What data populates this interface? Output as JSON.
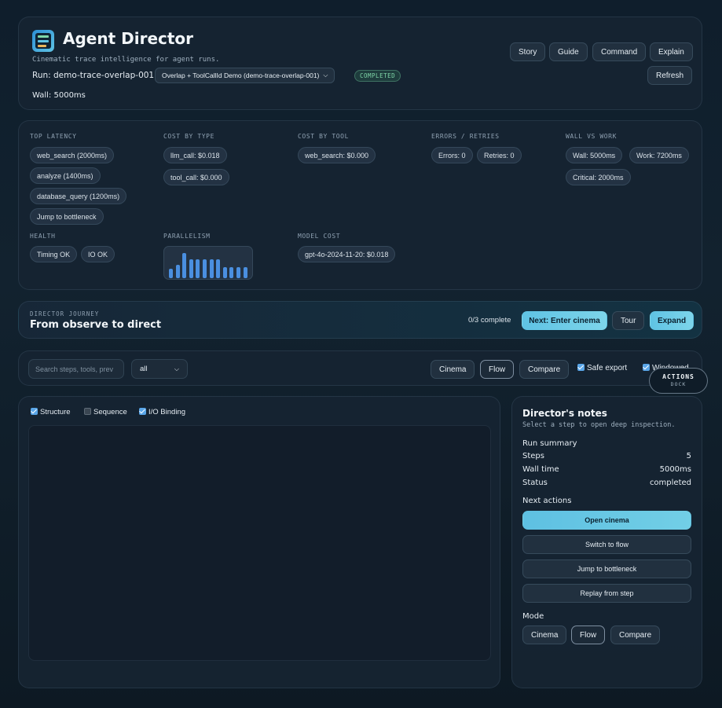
{
  "header": {
    "title": "Agent Director",
    "subtitle": "Cinematic trace intelligence for agent runs.",
    "run_label": "Run: demo-trace-overlap-001",
    "run_select": "Overlap + ToolCallId Demo (demo-trace-overlap-001)",
    "status_badge": "COMPLETED",
    "wall": "Wall: 5000ms",
    "buttons": {
      "story": "Story",
      "guide": "Guide",
      "command": "Command",
      "explain": "Explain",
      "refresh": "Refresh"
    }
  },
  "metrics": {
    "top_latency": {
      "label": "TOP LATENCY",
      "items": [
        "web_search (2000ms)",
        "analyze (1400ms)",
        "database_query (1200ms)",
        "Jump to bottleneck"
      ]
    },
    "cost_by_type": {
      "label": "COST BY TYPE",
      "items": [
        "llm_call: $0.018",
        "tool_call: $0.000"
      ]
    },
    "cost_by_tool": {
      "label": "COST BY TOOL",
      "items": [
        "web_search: $0.000"
      ]
    },
    "errors_retries": {
      "label": "ERRORS / RETRIES",
      "items": [
        "Errors: 0",
        "Retries: 0"
      ]
    },
    "wall_vs_work": {
      "label": "WALL VS WORK",
      "items": [
        "Wall: 5000ms",
        "Work: 7200ms",
        "Critical: 2000ms"
      ]
    },
    "health": {
      "label": "HEALTH",
      "items": [
        "Timing OK",
        "IO OK"
      ]
    },
    "parallelism": {
      "label": "PARALLELISM",
      "bar_levels": [
        0.35,
        0.5,
        0.95,
        0.7,
        0.7,
        0.7,
        0.7,
        0.7,
        0.4,
        0.4,
        0.4,
        0.4
      ]
    },
    "model_cost": {
      "label": "MODEL COST",
      "items": [
        "gpt-4o-2024-11-20: $0.018"
      ]
    }
  },
  "journey": {
    "eyebrow": "DIRECTOR JOURNEY",
    "title": "From observe to direct",
    "progress": "0/3 complete",
    "next_button": "Next: Enter cinema",
    "tour_button": "Tour",
    "expand_button": "Expand"
  },
  "toolbar": {
    "search_placeholder": "Search steps, tools, prev",
    "filter_value": "all",
    "cinema": "Cinema",
    "flow": "Flow",
    "compare": "Compare",
    "safe_export": "Safe export",
    "windowed": "Windowed",
    "actions_dock_title": "ACTIONS",
    "actions_dock_sub": "DOCK"
  },
  "canvas": {
    "toggles": [
      {
        "label": "Structure",
        "checked": true
      },
      {
        "label": "Sequence",
        "checked": false
      },
      {
        "label": "I/O Binding",
        "checked": true
      }
    ]
  },
  "notes": {
    "title": "Director's notes",
    "subtitle": "Select a step to open deep inspection.",
    "summary_title": "Run summary",
    "rows": [
      {
        "k": "Steps",
        "v": "5"
      },
      {
        "k": "Wall time",
        "v": "5000ms"
      },
      {
        "k": "Status",
        "v": "completed"
      }
    ],
    "next_actions_title": "Next actions",
    "actions": [
      "Open cinema",
      "Switch to flow",
      "Jump to bottleneck",
      "Replay from step"
    ],
    "mode_title": "Mode",
    "modes": [
      "Cinema",
      "Flow",
      "Compare"
    ]
  },
  "colors": {
    "accent": "#5fc3e4",
    "status_green": "#7fd6a8",
    "bar_blue": "#4a8fe0"
  }
}
